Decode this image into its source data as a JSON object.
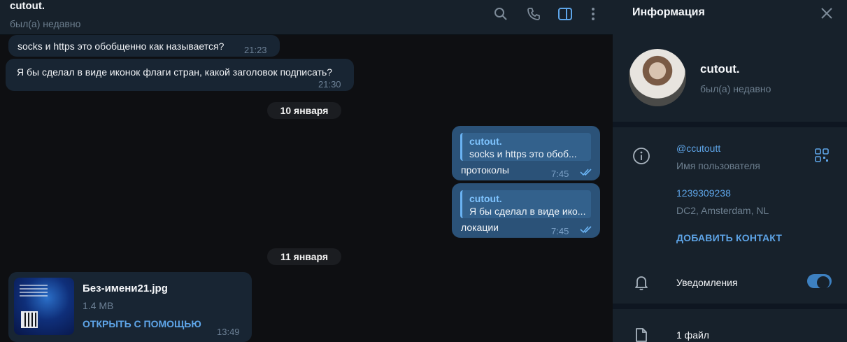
{
  "chat": {
    "title": "cutout.",
    "status": "был(а) недавно",
    "header_icons": [
      "search-icon",
      "phone-icon",
      "sidebar-toggle-icon",
      "more-vertical-icon"
    ],
    "messages": [
      {
        "text": "socks и https это обобщенно как называется?",
        "time": "21:23",
        "direction": "in"
      },
      {
        "text": "Я бы сделал в виде иконок флаги стран, какой заголовок подписать?",
        "time": "21:30",
        "direction": "in"
      }
    ],
    "date_1": "10 января",
    "replies": [
      {
        "reply_name": "cutout.",
        "reply_text": "socks и https это обоб...",
        "text": "протоколы",
        "time": "7:45"
      },
      {
        "reply_name": "cutout.",
        "reply_text": "Я бы сделал в виде ико...",
        "text": "локации",
        "time": "7:45"
      }
    ],
    "date_2": "11 января",
    "file": {
      "name": "Без-имени21.jpg",
      "size": "1.4 MB",
      "action": "ОТКРЫТЬ С ПОМОЩЬЮ",
      "time": "13:49"
    }
  },
  "info": {
    "title": "Информация",
    "name": "cutout.",
    "status": "был(а) недавно",
    "username": "@ccutoutt",
    "username_label": "Имя пользователя",
    "phone": "1239309238",
    "dc": "DC2, Amsterdam, NL",
    "add_contact": "ДОБАВИТЬ КОНТАКТ",
    "notifications": "Уведомления",
    "notifications_on": true,
    "files": "1 файл"
  },
  "colors": {
    "accent": "#5ea5e8",
    "panel": "#17212b",
    "bubble_in": "#182533",
    "bubble_out": "#2b5278"
  }
}
